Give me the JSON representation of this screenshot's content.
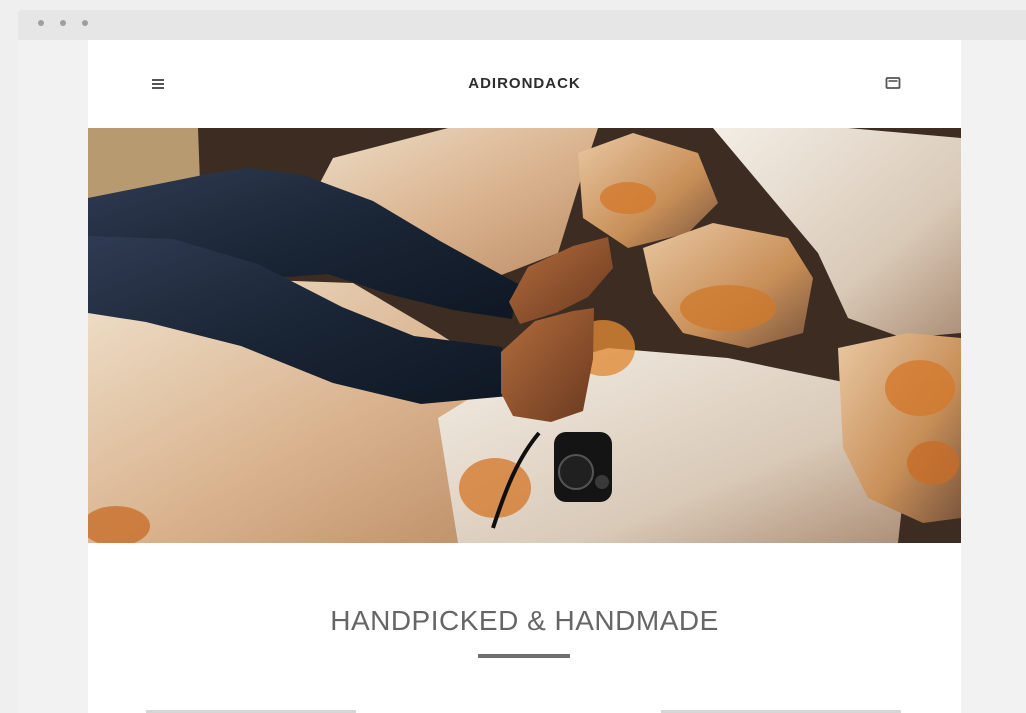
{
  "browser": {
    "window_dots": [
      "dot",
      "dot",
      "dot"
    ]
  },
  "header": {
    "brand": "ADIRONDACK",
    "menu_icon": "menu-icon",
    "cart_icon": "cart-icon"
  },
  "hero": {
    "image": "rocks-and-legs"
  },
  "section": {
    "title": "HANDPICKED & HANDMADE"
  },
  "colors": {
    "background": "#efefef",
    "page": "#ffffff",
    "text_primary": "#2d2d2d",
    "text_secondary": "#666666",
    "accent_rock": "#c8862d",
    "jeans": "#1f2b3c"
  }
}
